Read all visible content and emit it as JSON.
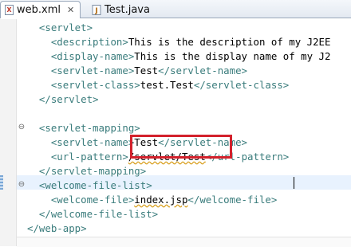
{
  "tabs": [
    {
      "label": "web.xml",
      "icon": "xml-file-icon",
      "active": true,
      "close": "✕"
    },
    {
      "label": "Test.java",
      "icon": "java-file-icon",
      "active": false
    }
  ],
  "code_lines": [
    {
      "indent": "  ",
      "parts": [
        {
          "t": "tag",
          "v": "<servlet>"
        }
      ]
    },
    {
      "indent": "    ",
      "parts": [
        {
          "t": "tag",
          "v": "<description>"
        },
        {
          "t": "txt",
          "v": "This is the description of my J2EE"
        }
      ]
    },
    {
      "indent": "    ",
      "parts": [
        {
          "t": "tag",
          "v": "<display-name>"
        },
        {
          "t": "txt",
          "v": "This is the display name of my J2"
        }
      ]
    },
    {
      "indent": "    ",
      "parts": [
        {
          "t": "tag",
          "v": "<servlet-name>"
        },
        {
          "t": "txt",
          "v": "Test"
        },
        {
          "t": "tag",
          "v": "</servlet-name>"
        }
      ]
    },
    {
      "indent": "    ",
      "parts": [
        {
          "t": "tag",
          "v": "<servlet-class>"
        },
        {
          "t": "txt",
          "v": "test.Test"
        },
        {
          "t": "tag",
          "v": "</servlet-class>"
        }
      ]
    },
    {
      "indent": "  ",
      "parts": [
        {
          "t": "tag",
          "v": "</servlet>"
        }
      ]
    },
    {
      "indent": "",
      "parts": []
    },
    {
      "indent": "  ",
      "parts": [
        {
          "t": "tag",
          "v": "<servlet-mapping>"
        }
      ]
    },
    {
      "indent": "    ",
      "parts": [
        {
          "t": "tag",
          "v": "<servlet-name>"
        },
        {
          "t": "txt",
          "v": "Test"
        },
        {
          "t": "tag",
          "v": "</servlet-name>"
        }
      ]
    },
    {
      "indent": "    ",
      "parts": [
        {
          "t": "tag",
          "v": "<url-pattern>"
        },
        {
          "t": "txt",
          "v": "/servlet/Test",
          "squiggle": true
        },
        {
          "t": "tag",
          "v": "</url-pattern>"
        }
      ]
    },
    {
      "indent": "  ",
      "parts": [
        {
          "t": "tag",
          "v": "</servlet-mapping>"
        }
      ]
    },
    {
      "indent": "  ",
      "parts": [
        {
          "t": "tag",
          "v": "<welcome-file-list>"
        }
      ]
    },
    {
      "indent": "    ",
      "parts": [
        {
          "t": "tag",
          "v": "<welcome-file>"
        },
        {
          "t": "txt",
          "v": "index.jsp",
          "squiggle": true
        },
        {
          "t": "tag",
          "v": "</welcome-file>"
        }
      ]
    },
    {
      "indent": "  ",
      "parts": [
        {
          "t": "tag",
          "v": "</welcome-file-list>"
        }
      ]
    },
    {
      "indent": "",
      "parts": [
        {
          "t": "tag",
          "v": "</web-app>"
        }
      ]
    }
  ],
  "fold_markers": [
    {
      "line": 7,
      "symbol": "⊖"
    },
    {
      "line": 11,
      "symbol": "⊖"
    }
  ],
  "colors": {
    "tag": "#3a7c7c",
    "text": "#000000",
    "highlight_box": "#d3212c",
    "current_line": "#e8f2fe"
  },
  "highlight": {
    "line": 9,
    "target": "/servlet/Test"
  },
  "current_line": 12
}
